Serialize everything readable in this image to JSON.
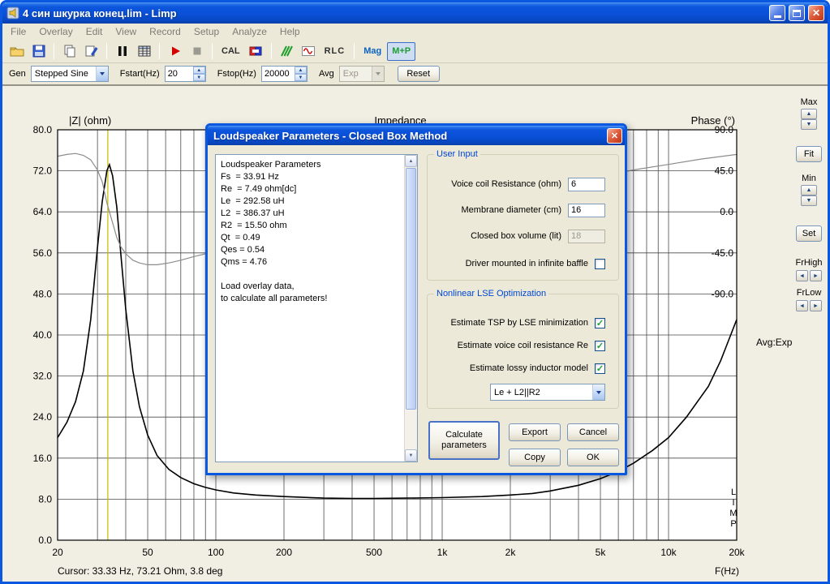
{
  "window": {
    "title": "4 син шкурка конец.lim - Limp"
  },
  "menu": {
    "items": [
      "File",
      "Overlay",
      "Edit",
      "View",
      "Record",
      "Setup",
      "Analyze",
      "Help"
    ]
  },
  "toolbar": {
    "cal_label": "CAL",
    "rlc_label": "RLC",
    "mag_label": "Mag",
    "mp_label": "M+P"
  },
  "genbar": {
    "gen_label": "Gen",
    "gen_value": "Stepped Sine",
    "fstart_label": "Fstart(Hz)",
    "fstart_value": "20",
    "fstop_label": "Fstop(Hz)",
    "fstop_value": "20000",
    "avg_label": "Avg",
    "avg_value": "Exp",
    "reset_label": "Reset"
  },
  "side_panel": {
    "max_label": "Max",
    "fit_label": "Fit",
    "min_label": "Min",
    "set_label": "Set",
    "frhigh_label": "FrHigh",
    "frlow_label": "FrLow",
    "avg_exp": "Avg:Exp"
  },
  "statusbar": {
    "cursor_text": "Cursor: 33.33 Hz, 73.21 Ohm, 3.8 deg"
  },
  "chart_data": {
    "type": "line",
    "title": "Impedance",
    "xlabel": "F(Hz)",
    "ylabel_left": "|Z| (ohm)",
    "ylabel_right": "Phase (°)",
    "x_scale": "log",
    "xlim": [
      20,
      20000
    ],
    "ylim_left": [
      0,
      80
    ],
    "y_left_ticks": [
      80,
      72,
      64,
      56,
      48,
      40,
      32,
      24,
      16,
      8,
      0
    ],
    "x_ticks": [
      [
        20,
        "20"
      ],
      [
        50,
        "50"
      ],
      [
        100,
        "100"
      ],
      [
        200,
        "200"
      ],
      [
        500,
        "500"
      ],
      [
        1000,
        "1k"
      ],
      [
        2000,
        "2k"
      ],
      [
        5000,
        "5k"
      ],
      [
        10000,
        "10k"
      ],
      [
        20000,
        "20k"
      ]
    ],
    "x_gridlines": [
      30,
      40,
      50,
      60,
      70,
      80,
      90,
      100,
      200,
      300,
      400,
      500,
      600,
      700,
      800,
      900,
      1000,
      2000,
      3000,
      4000,
      5000,
      6000,
      7000,
      8000,
      9000,
      10000
    ],
    "phase_ticks": [
      90,
      45,
      0,
      -45,
      -90
    ],
    "phase_axis_z_zero": 64,
    "phase_axis_z_per_90deg": 16,
    "grid": true,
    "cursor": {
      "freq": 33.33,
      "z": 73.21,
      "phase_deg": 3.8,
      "color": "#C9B700"
    },
    "watermark": [
      "L",
      "I",
      "M",
      "P"
    ],
    "series": [
      {
        "name": "impedance",
        "axis": "left",
        "color": "#000000",
        "points": [
          [
            20,
            20
          ],
          [
            22,
            23
          ],
          [
            24,
            27
          ],
          [
            26,
            33
          ],
          [
            28,
            43
          ],
          [
            30,
            57
          ],
          [
            31.5,
            66
          ],
          [
            33,
            72
          ],
          [
            33.9,
            73.2
          ],
          [
            35,
            71
          ],
          [
            36.5,
            65
          ],
          [
            38,
            56
          ],
          [
            40,
            45
          ],
          [
            43,
            33
          ],
          [
            46,
            26
          ],
          [
            50,
            20.5
          ],
          [
            55,
            16.5
          ],
          [
            62,
            13.8
          ],
          [
            70,
            12.2
          ],
          [
            80,
            11.0
          ],
          [
            90,
            10.3
          ],
          [
            100,
            9.8
          ],
          [
            120,
            9.2
          ],
          [
            150,
            8.8
          ],
          [
            200,
            8.5
          ],
          [
            300,
            8.2
          ],
          [
            400,
            8.15
          ],
          [
            500,
            8.15
          ],
          [
            700,
            8.2
          ],
          [
            1000,
            8.3
          ],
          [
            1500,
            8.5
          ],
          [
            2000,
            8.8
          ],
          [
            2500,
            9.1
          ],
          [
            3000,
            9.6
          ],
          [
            4000,
            10.7
          ],
          [
            5000,
            12.0
          ],
          [
            6000,
            13.4
          ],
          [
            7000,
            15.0
          ],
          [
            8500,
            17.5
          ],
          [
            10000,
            20.0
          ],
          [
            12000,
            24.0
          ],
          [
            15000,
            30.0
          ],
          [
            17000,
            35.0
          ],
          [
            20000,
            43.0
          ]
        ]
      },
      {
        "name": "phase",
        "axis": "phase",
        "color": "#8C8C8C",
        "points": [
          [
            20,
            61
          ],
          [
            22,
            63
          ],
          [
            24,
            64
          ],
          [
            26,
            62
          ],
          [
            28,
            57
          ],
          [
            30,
            46
          ],
          [
            31.5,
            33
          ],
          [
            33,
            10
          ],
          [
            33.9,
            0
          ],
          [
            35,
            -12
          ],
          [
            36.5,
            -28
          ],
          [
            38,
            -38
          ],
          [
            40,
            -46
          ],
          [
            43,
            -53
          ],
          [
            46,
            -56
          ],
          [
            50,
            -58
          ],
          [
            55,
            -58
          ],
          [
            62,
            -56
          ],
          [
            70,
            -53
          ],
          [
            80,
            -49
          ],
          [
            90,
            -46
          ],
          [
            100,
            -43
          ],
          [
            120,
            -37
          ],
          [
            150,
            -31
          ],
          [
            200,
            -23
          ],
          [
            300,
            -13
          ],
          [
            400,
            -7
          ],
          [
            500,
            -3
          ],
          [
            700,
            3
          ],
          [
            1000,
            9
          ],
          [
            1500,
            16
          ],
          [
            2000,
            21
          ],
          [
            3000,
            29
          ],
          [
            4000,
            35
          ],
          [
            5000,
            39
          ],
          [
            7000,
            46
          ],
          [
            10000,
            52
          ],
          [
            14000,
            58
          ],
          [
            20000,
            63
          ]
        ]
      }
    ]
  },
  "dialog": {
    "title": "Loudspeaker Parameters - Closed Box Method",
    "params_lines": [
      "Loudspeaker Parameters",
      "Fs  = 33.91 Hz",
      "Re  = 7.49 ohm[dc]",
      "Le  = 292.58 uH",
      "L2  = 386.37 uH",
      "R2  = 15.50 ohm",
      "Qt  = 0.49",
      "Qes = 0.54",
      "Qms = 4.76",
      "",
      "Load overlay data,",
      "to calculate all parameters!"
    ],
    "user_input": {
      "legend": "User Input",
      "rows": [
        {
          "label": "Voice coil Resistance (ohm)",
          "value": "6"
        },
        {
          "label": "Membrane diameter (cm)",
          "value": "16"
        },
        {
          "label": "Closed box volume (lit)",
          "value": "18"
        },
        {
          "label": "Driver mounted in infinite baffle",
          "check": ""
        }
      ]
    },
    "lse": {
      "legend": "Nonlinear LSE Optimization",
      "rows": [
        {
          "label": "Estimate TSP by LSE minimization",
          "check": "✓"
        },
        {
          "label": "Estimate voice coil resistance Re",
          "check": "✓"
        },
        {
          "label": "Estimate lossy inductor model",
          "check": "✓"
        }
      ],
      "model_value": "Le + L2||R2"
    },
    "buttons": {
      "calculate": "Calculate parameters",
      "export": "Export",
      "cancel": "Cancel",
      "copy": "Copy",
      "ok": "OK"
    }
  }
}
